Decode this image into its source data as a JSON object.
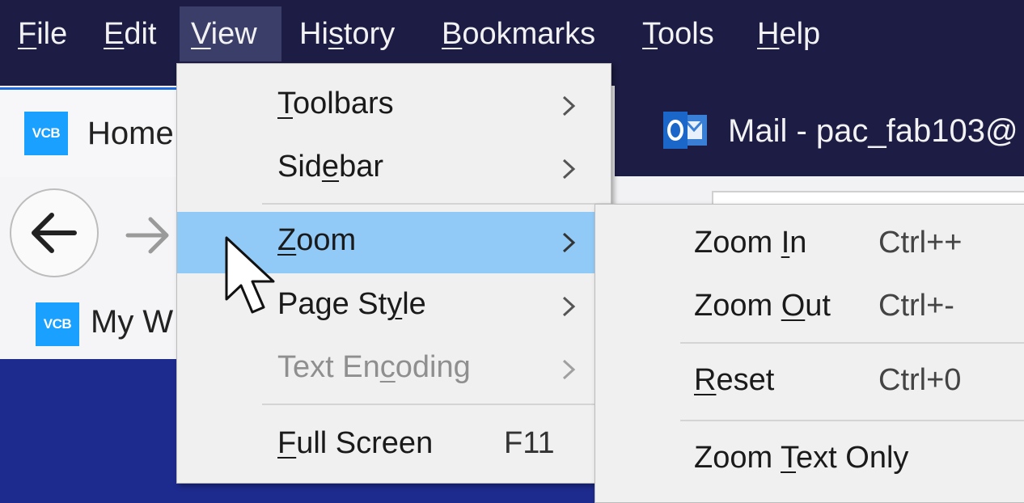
{
  "menubar": {
    "items": [
      {
        "label": "File",
        "mnemonic": "F",
        "rest": "ile"
      },
      {
        "label": "Edit",
        "mnemonic": "E",
        "rest": "dit"
      },
      {
        "label": "View",
        "mnemonic": "V",
        "rest": "iew"
      },
      {
        "label": "History",
        "pre": "Hi",
        "mnemonic": "s",
        "rest": "tory"
      },
      {
        "label": "Bookmarks",
        "mnemonic": "B",
        "rest": "ookmarks"
      },
      {
        "label": "Tools",
        "mnemonic": "T",
        "rest": "ools"
      },
      {
        "label": "Help",
        "mnemonic": "H",
        "rest": "elp"
      }
    ]
  },
  "tabs": {
    "home": {
      "favicon": "VCB",
      "title": "Home"
    },
    "mail": {
      "title": "Mail - pac_fab103@"
    }
  },
  "bookmarks": {
    "item": {
      "favicon": "VCB",
      "title": "My W"
    }
  },
  "view_menu": {
    "toolbars": {
      "pre": "",
      "mn": "T",
      "post": "oolbars"
    },
    "sidebar": {
      "pre": "Sid",
      "mn": "e",
      "post": "bar"
    },
    "zoom": {
      "pre": "",
      "mn": "Z",
      "post": "oom"
    },
    "page_style": {
      "pre": "Page St",
      "mn": "y",
      "post": "le"
    },
    "text_encoding": {
      "pre": "Text En",
      "mn": "c",
      "post": "oding"
    },
    "full_screen": {
      "pre": "",
      "mn": "F",
      "post": "ull Screen",
      "shortcut": "F11"
    }
  },
  "zoom_menu": {
    "zoom_in": {
      "pre": "Zoom ",
      "mn": "I",
      "post": "n",
      "shortcut": "Ctrl++"
    },
    "zoom_out": {
      "pre": "Zoom ",
      "mn": "O",
      "post": "ut",
      "shortcut": "Ctrl+-"
    },
    "reset": {
      "pre": "",
      "mn": "R",
      "post": "eset",
      "shortcut": "Ctrl+0"
    },
    "zoom_text_only": {
      "pre": "Zoom ",
      "mn": "T",
      "post": "ext Only"
    }
  },
  "colors": {
    "menubar": "#1c1c44",
    "highlight": "#91c9f7",
    "menu_bg": "#f0f0f0",
    "page_bg": "#1e2b8e"
  },
  "icons": [
    "back-arrow-icon",
    "forward-arrow-icon",
    "submenu-arrow-icon",
    "outlook-icon",
    "mouse-pointer-icon"
  ]
}
